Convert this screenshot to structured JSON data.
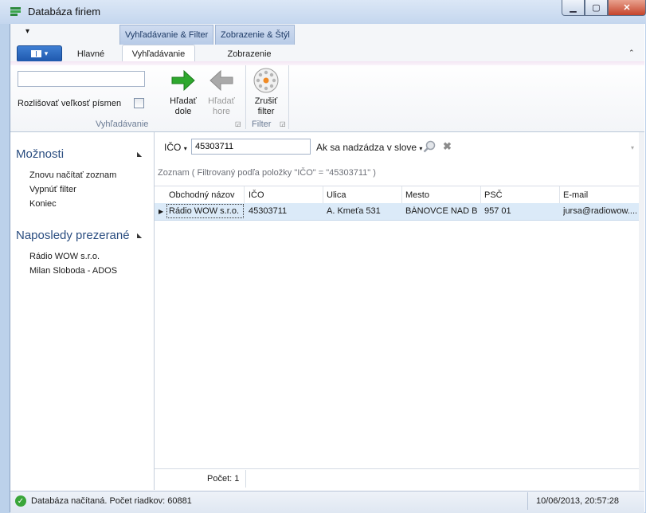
{
  "window": {
    "title": "Databáza firiem",
    "controls": {
      "minimize": "▁",
      "maximize": "▢",
      "close": "✕"
    }
  },
  "ribbon": {
    "qat_label": "▾",
    "contextual_tabs": [
      "Vyhľadávanie & Filter",
      "Zobrazenie & Štýl"
    ],
    "tabs": [
      "Hlavné",
      "Vyhľadávanie",
      "Zobrazenie"
    ],
    "active_tab": "Vyhľadávanie",
    "collapse": "⌃",
    "search": {
      "value": "",
      "case_label": "Rozlišovať veľkosť písmen"
    },
    "buttons": {
      "find_down": "Hľadať\ndole",
      "find_up": "Hľadať\nhore",
      "clear_filter": "Zrušiť\nfilter"
    },
    "groups": {
      "search": "Vyhľadávanie",
      "filter": "Filter"
    }
  },
  "left_panel": {
    "options_title": "Možnosti",
    "options": [
      "Znovu načítať zoznam",
      "Vypnúť filter",
      "Koniec"
    ],
    "recent_title": "Naposledy prezerané",
    "recent": [
      "Rádio WOW s.r.o.",
      "Milan Sloboda - ADOS"
    ]
  },
  "filter_bar": {
    "field": "IČO",
    "value": "45303711",
    "match_mode": "Ak sa nadzádza v slove"
  },
  "list": {
    "caption": "Zoznam ( Filtrovaný podľa položky \"IČO\" = \"45303711\" )",
    "columns": [
      "Obchodný názov",
      "IČO",
      "Ulica",
      "Mesto",
      "PSČ",
      "E-mail"
    ],
    "rows": [
      [
        "Rádio WOW s.r.o.",
        "45303711",
        "A. Kmeťa 531",
        "BÁNOVCE NAD B...",
        "957 01",
        "jursa@radiowow...."
      ]
    ],
    "count": "Počet: 1"
  },
  "status": {
    "text": "Databáza načítaná. Počet riadkov: 60881",
    "datetime": "10/06/2013, 20:57:28"
  },
  "colors": {
    "accent": "#2a4d80",
    "selected_row": "#dbeaf8",
    "arrow_green": "#2ea82e"
  }
}
